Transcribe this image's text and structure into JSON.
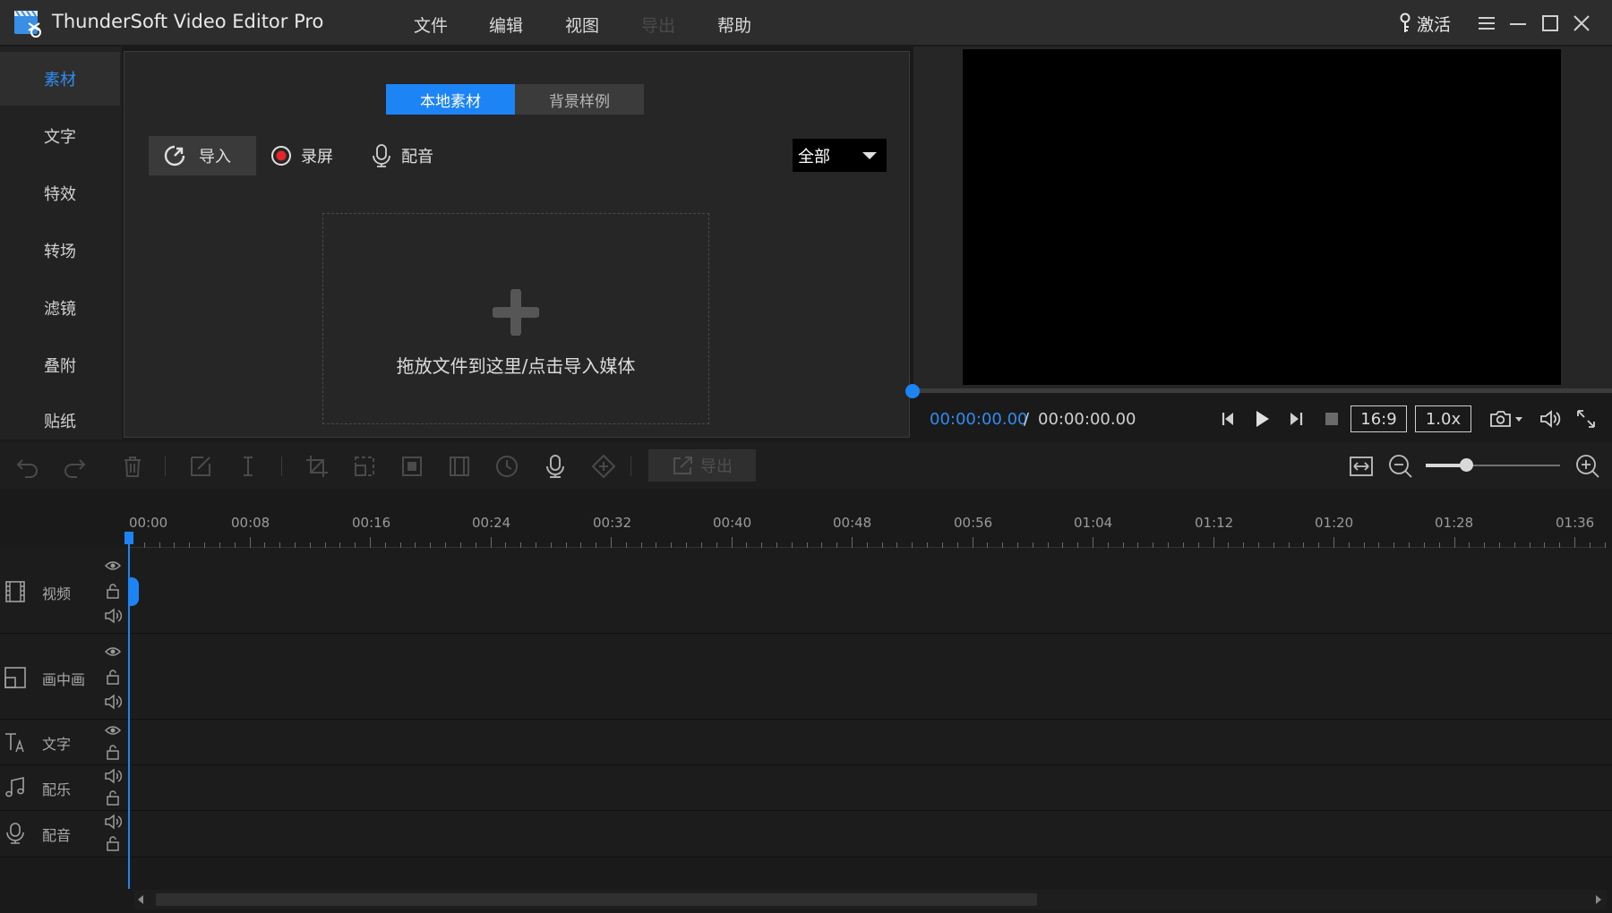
{
  "app": {
    "title": "ThunderSoft Video Editor Pro"
  },
  "menu": [
    {
      "label": "文件",
      "disabled": false
    },
    {
      "label": "编辑",
      "disabled": false
    },
    {
      "label": "视图",
      "disabled": false
    },
    {
      "label": "导出",
      "disabled": true
    },
    {
      "label": "帮助",
      "disabled": false
    }
  ],
  "titlebar": {
    "activate_label": "激活"
  },
  "categories": [
    {
      "label": "素材",
      "active": true
    },
    {
      "label": "文字",
      "active": false
    },
    {
      "label": "特效",
      "active": false
    },
    {
      "label": "转场",
      "active": false
    },
    {
      "label": "滤镜",
      "active": false
    },
    {
      "label": "叠附",
      "active": false
    },
    {
      "label": "贴纸",
      "active": false
    }
  ],
  "media": {
    "tabs": [
      {
        "label": "本地素材",
        "active": true
      },
      {
        "label": "背景样例",
        "active": false
      }
    ],
    "import_label": "导入",
    "record_label": "录屏",
    "voice_label": "配音",
    "filter_value": "全部",
    "drop_text": "拖放文件到这里/点击导入媒体"
  },
  "preview": {
    "time_current": "00:00:00.00",
    "time_separator": "/",
    "time_total": "00:00:00.00",
    "aspect_ratio": "16:9",
    "speed": "1.0x",
    "progress": 0
  },
  "toolbar": {
    "export_label": "导出",
    "zoom_level": 0.27
  },
  "timeline": {
    "ruler_labels": [
      "00:00",
      "00:08",
      "00:16",
      "00:24",
      "00:32",
      "00:40",
      "00:48",
      "00:56",
      "01:04",
      "01:12",
      "01:20",
      "01:28",
      "01:36"
    ],
    "tracks": [
      {
        "name": "视频",
        "icon": "film-icon"
      },
      {
        "name": "画中画",
        "icon": "pip-icon"
      },
      {
        "name": "文字",
        "icon": "text-icon"
      },
      {
        "name": "配乐",
        "icon": "music-icon"
      },
      {
        "name": "配音",
        "icon": "microphone-icon"
      }
    ]
  },
  "colors": {
    "accent": "#1d84f5",
    "background": "#1a1a1a",
    "panel": "#262626",
    "titlebar": "#2d2d2d"
  }
}
